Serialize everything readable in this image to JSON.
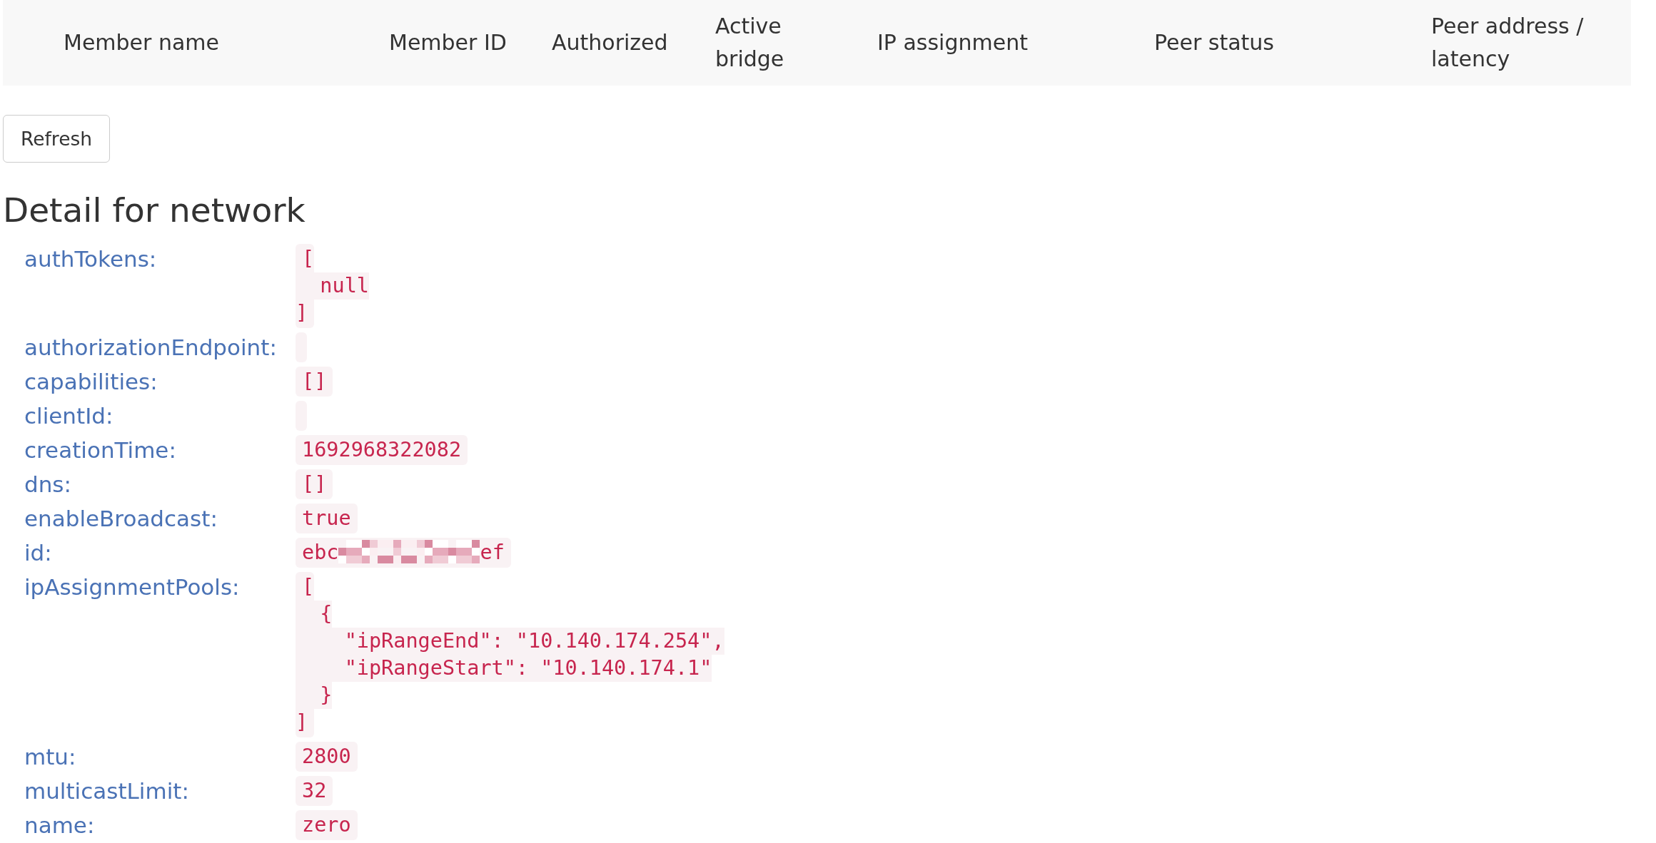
{
  "table": {
    "columns": [
      "Member name",
      "Member ID",
      "Authorized",
      "Active bridge",
      "IP assignment",
      "Peer status",
      "Peer address / latency"
    ]
  },
  "refresh_button": {
    "label": "Refresh"
  },
  "detail": {
    "title": "Detail for network",
    "fields": [
      {
        "key": "authTokens:",
        "kind": "text",
        "value": "[\n  null\n]"
      },
      {
        "key": "authorizationEndpoint:",
        "kind": "empty"
      },
      {
        "key": "capabilities:",
        "kind": "text",
        "value": "[]"
      },
      {
        "key": "clientId:",
        "kind": "empty"
      },
      {
        "key": "creationTime:",
        "kind": "text",
        "value": "1692968322082"
      },
      {
        "key": "dns:",
        "kind": "text",
        "value": "[]"
      },
      {
        "key": "enableBroadcast:",
        "kind": "text",
        "value": "true"
      },
      {
        "key": "id:",
        "kind": "redacted",
        "value_start": "ebc",
        "value_end": "ef"
      },
      {
        "key": "ipAssignmentPools:",
        "kind": "text",
        "value": "[\n  {\n    \"ipRangeEnd\": \"10.140.174.254\",\n    \"ipRangeStart\": \"10.140.174.1\"\n  }\n]"
      },
      {
        "key": "mtu:",
        "kind": "text",
        "value": "2800"
      },
      {
        "key": "multicastLimit:",
        "kind": "text",
        "value": "32"
      },
      {
        "key": "name:",
        "kind": "text",
        "value": "zero"
      }
    ]
  }
}
